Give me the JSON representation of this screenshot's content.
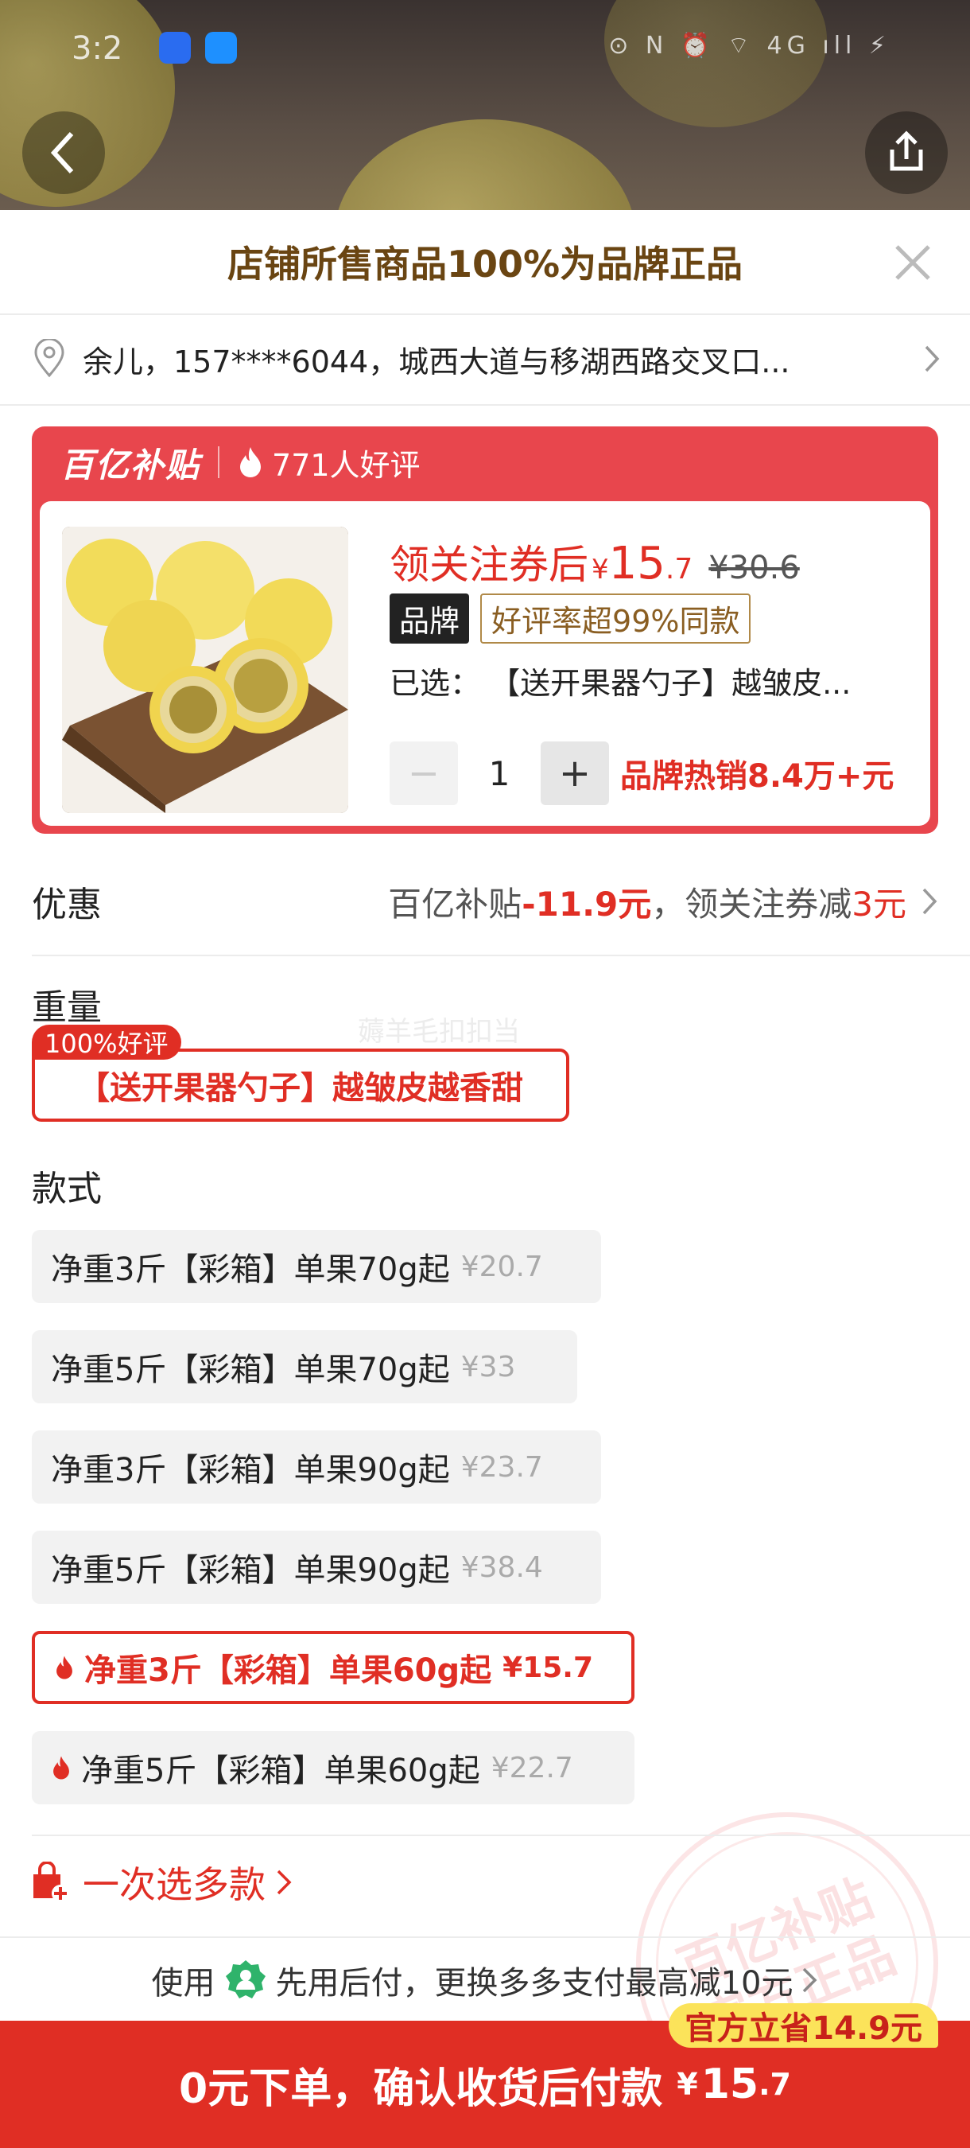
{
  "status_bar": {
    "time": "3:2",
    "right_icons": "⊙ N ⏰ ⌔ 4G ıll ⚡"
  },
  "header": {
    "promo_title": "店铺所售商品100%为品牌正品"
  },
  "address": {
    "text": "余儿，157****6044，城西大道与移湖西路交叉口..."
  },
  "card": {
    "brand_logo": "百亿补贴",
    "good_reviews": "771人好评",
    "price_label": "领关注券后",
    "price_yen": "¥",
    "price_int": "15",
    "price_dec": ".7",
    "original_price": "¥30.6",
    "tag_brand": "品牌",
    "tag_rate": "好评率超99%同款",
    "selected": "已选：  【送开果器勺子】越皱皮...",
    "minus": "−",
    "quantity": "1",
    "plus": "+",
    "hot_sale": "品牌热销8.4万+元"
  },
  "discount": {
    "label": "优惠",
    "subsidy_prefix": "百亿补贴",
    "subsidy_amount": "-11.9元",
    "coupon_prefix": "，领关注券减",
    "coupon_amount": "3元"
  },
  "weight": {
    "title": "重量",
    "badge": "100%好评",
    "option": "【送开果器勺子】越皱皮越香甜",
    "watermark": "薅羊毛扣扣当"
  },
  "style": {
    "title": "款式",
    "options": [
      {
        "label": "净重3斤【彩箱】单果70g起",
        "price": "¥20.7"
      },
      {
        "label": "净重5斤【彩箱】单果70g起",
        "price": "¥33"
      },
      {
        "label": "净重3斤【彩箱】单果90g起",
        "price": "¥23.7"
      },
      {
        "label": "净重5斤【彩箱】单果90g起",
        "price": "¥38.4"
      },
      {
        "label": "净重3斤【彩箱】单果60g起",
        "price": "¥15.7"
      },
      {
        "label": "净重5斤【彩箱】单果60g起",
        "price": "¥22.7"
      }
    ]
  },
  "stamp": {
    "line1": "百亿补贴",
    "line2": "官方正品"
  },
  "multi_select": {
    "label": "一次选多款"
  },
  "pay_later": {
    "prefix": "使用",
    "text": "先用后付，更换多多支付最高减10元"
  },
  "bottom": {
    "save_badge": "官方立省14.9元",
    "label": "0元下单，确认收货后付款",
    "yen": "¥",
    "int": "15",
    "dec": ".7"
  },
  "colors": {
    "accent": "#e02e24",
    "card": "#e8464d",
    "gold_text": "#6a4512",
    "badge_yellow": "#fbe35a"
  }
}
